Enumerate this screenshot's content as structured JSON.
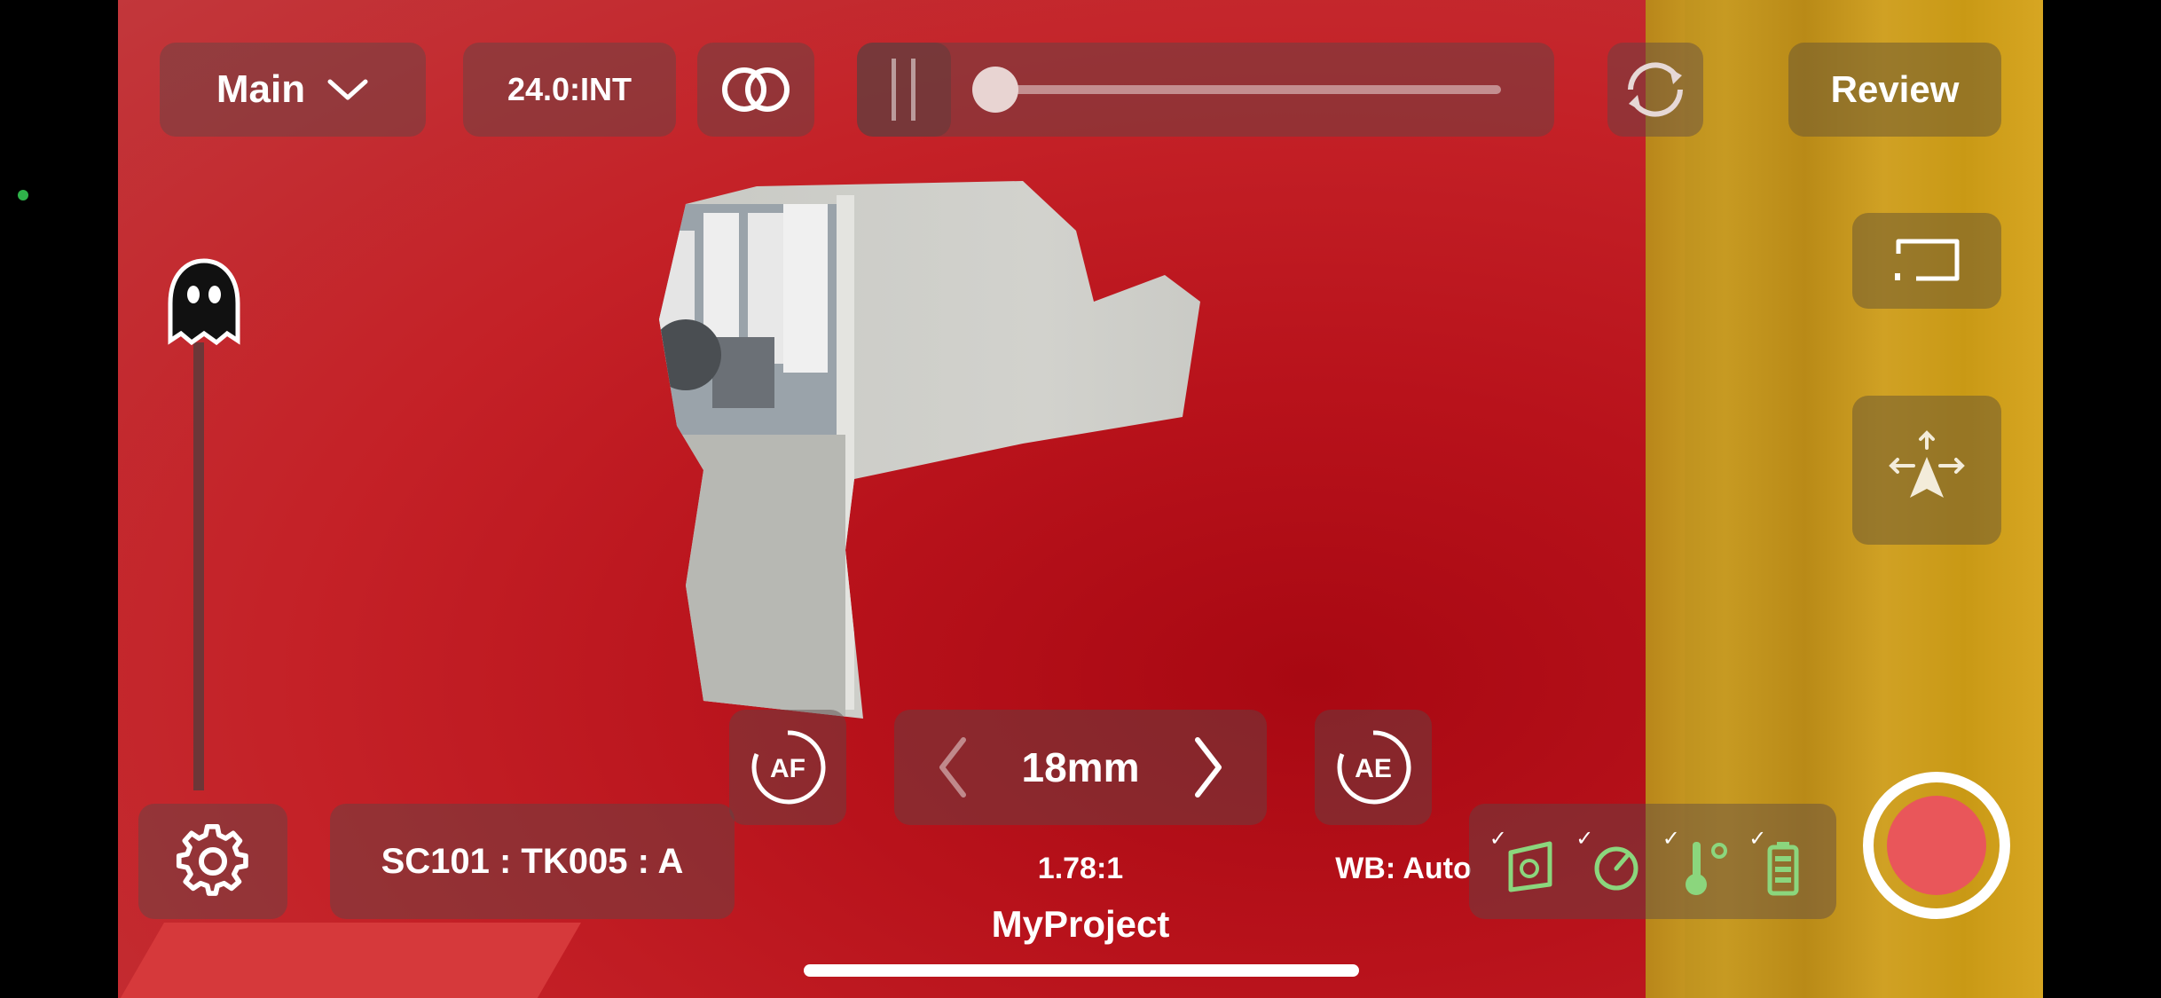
{
  "app": {
    "camera_select": "Main",
    "frame_rate": "24.0:INT",
    "review_label": "Review",
    "focal_length": "18mm",
    "take_id": "SC101 : TK005 : A",
    "aspect_ratio": "1.78:1",
    "white_balance": "WB: Auto",
    "project_name": "MyProject",
    "af_label": "AF",
    "ae_label": "AE"
  },
  "status": {
    "items": [
      {
        "icon": "storage-icon",
        "check": "✓"
      },
      {
        "icon": "speed-icon",
        "check": "✓"
      },
      {
        "icon": "temperature-icon",
        "check": "✓"
      },
      {
        "icon": "battery-icon",
        "check": "✓"
      }
    ]
  },
  "colors": {
    "record": "#e9565a",
    "status_ok": "#8bd67d",
    "scene_red": "#b8121b",
    "scene_yellow": "#c99915"
  }
}
